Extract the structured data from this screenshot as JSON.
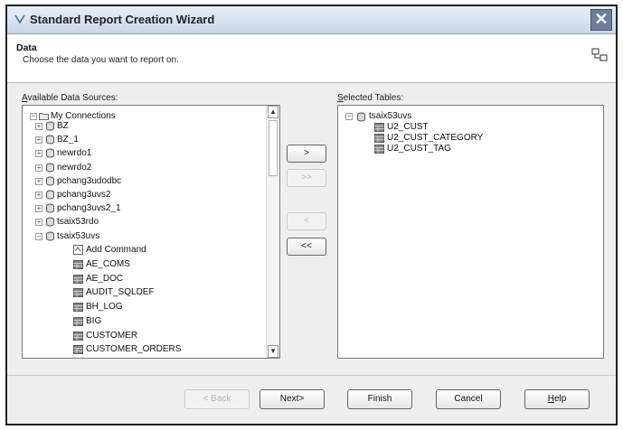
{
  "window": {
    "title": "Standard Report Creation Wizard",
    "close_glyph": "✕"
  },
  "header": {
    "title": "Data",
    "subtitle": "Choose the data you want to report on."
  },
  "available": {
    "label_hotkey": "A",
    "label_rest": "vailable Data Sources:",
    "root": "My Connections",
    "connections": [
      "BZ",
      "BZ_1",
      "newrdo1",
      "newrdo2",
      "pchang3udodbc",
      "pchang3uvs2",
      "pchang3uvs2_1",
      "tsaix53rdo",
      "tsaix53uvs"
    ],
    "add_command": "Add Command",
    "tables": [
      "AE_COMS",
      "AE_DOC",
      "AUDIT_SQLDEF",
      "BH_LOG",
      "BIG",
      "CUSTOMER",
      "CUSTOMER_ORDERS"
    ]
  },
  "selected": {
    "label_hotkey": "S",
    "label_rest": "elected Tables:",
    "connection": "tsaix53uvs",
    "tables": [
      "U2_CUST",
      "U2_CUST_CATEGORY",
      "U2_CUST_TAG"
    ]
  },
  "transfer": {
    "add_one": ">",
    "add_all": ">>",
    "remove_one": "<",
    "remove_all": "<<"
  },
  "footer": {
    "back": "< Back",
    "next": "Next>",
    "finish": "Finish",
    "cancel": "Cancel",
    "help_hotkey": "H",
    "help_rest": "elp"
  }
}
